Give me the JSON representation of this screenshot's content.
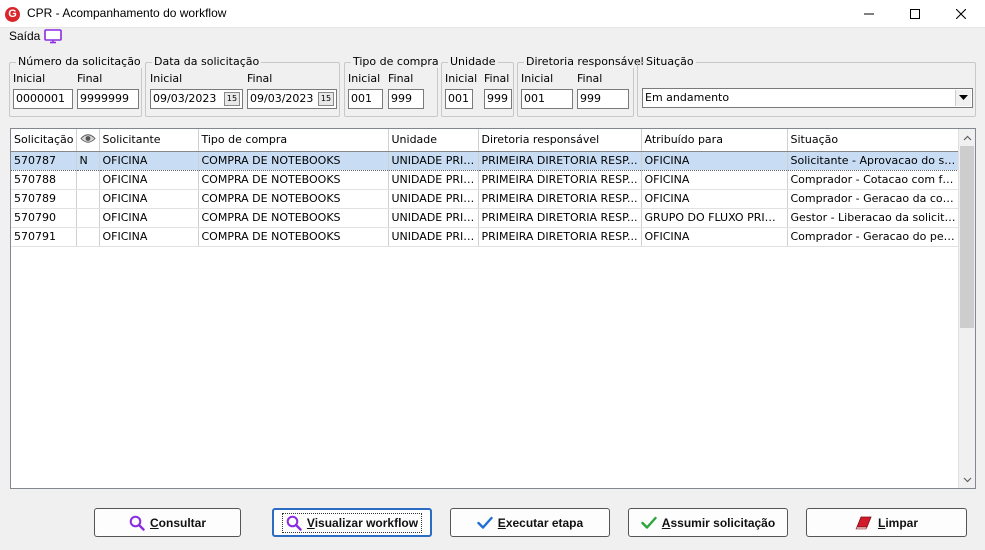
{
  "window": {
    "title": "CPR - Acompanhamento do workflow",
    "app_icon": "G"
  },
  "menu": {
    "saida": "Saída"
  },
  "filters": {
    "numero": {
      "title": "Número da solicitação",
      "inicial_label": "Inicial",
      "final_label": "Final",
      "inicial_value": "0000001",
      "final_value": "9999999"
    },
    "data": {
      "title": "Data da solicitação",
      "inicial_label": "Inicial",
      "final_label": "Final",
      "inicial_value": "09/03/2023",
      "final_value": "09/03/2023",
      "cal_glyph": "15"
    },
    "tipo": {
      "title": "Tipo de compra",
      "inicial_label": "Inicial",
      "final_label": "Final",
      "inicial_value": "001",
      "final_value": "999"
    },
    "unidade": {
      "title": "Unidade",
      "inicial_label": "Inicial",
      "final_label": "Final",
      "inicial_value": "001",
      "final_value": "999"
    },
    "diretoria": {
      "title": "Diretoria responsável",
      "inicial_label": "Inicial",
      "final_label": "Final",
      "inicial_value": "001",
      "final_value": "999"
    },
    "situacao": {
      "title": "Situação",
      "selected": "Em andamento"
    }
  },
  "grid": {
    "headers": [
      "Solicitação",
      "",
      "Solicitante",
      "Tipo de compra",
      "Unidade",
      "Diretoria responsável",
      "Atribuído para",
      "Situação"
    ],
    "rows": [
      [
        "570787",
        "N",
        "OFICINA",
        "COMPRA DE NOTEBOOKS",
        "UNIDADE PRIN...",
        "PRIMEIRA DIRETORIA RESP...",
        "OFICINA",
        "Solicitante - Aprovacao do solicit..."
      ],
      [
        "570788",
        "",
        "OFICINA",
        "COMPRA DE NOTEBOOKS",
        "UNIDADE PRIN...",
        "PRIMEIRA DIRETORIA RESP...",
        "OFICINA",
        "Comprador - Cotacao com fornec..."
      ],
      [
        "570789",
        "",
        "OFICINA",
        "COMPRA DE NOTEBOOKS",
        "UNIDADE PRIN...",
        "PRIMEIRA DIRETORIA RESP...",
        "OFICINA",
        "Comprador - Geracao da cotacao"
      ],
      [
        "570790",
        "",
        "OFICINA",
        "COMPRA DE NOTEBOOKS",
        "UNIDADE PRIN...",
        "PRIMEIRA DIRETORIA RESP...",
        "GRUPO DO FLUXO PRINC...",
        "Gestor - Liberacao da solicitacao ..."
      ],
      [
        "570791",
        "",
        "OFICINA",
        "COMPRA DE NOTEBOOKS",
        "UNIDADE PRIN...",
        "PRIMEIRA DIRETORIA RESP...",
        "OFICINA",
        "Comprador - Geracao do pedido"
      ]
    ]
  },
  "buttons": {
    "consultar": {
      "first": "C",
      "rest": "onsultar"
    },
    "visualizar": {
      "first": "V",
      "rest": "isualizar workflow"
    },
    "executar": {
      "first": "E",
      "rest": "xecutar etapa"
    },
    "assumir": {
      "first": "A",
      "rest": "ssumir solicitação"
    },
    "limpar": {
      "first": "L",
      "rest": "impar"
    }
  },
  "colors": {
    "accent": "#2b6cc4",
    "selection": "#c8dcf4",
    "magnifier": "#8a2be2",
    "check_blue": "#1f6fd0",
    "check_green": "#2aa63a",
    "eraser": "#d11a2a"
  },
  "icons": {
    "app": "app-logo-icon",
    "monitor": "monitor-icon",
    "eye": "eye-icon",
    "search": "magnifier-icon",
    "check": "checkmark-icon",
    "eraser": "eraser-icon"
  }
}
